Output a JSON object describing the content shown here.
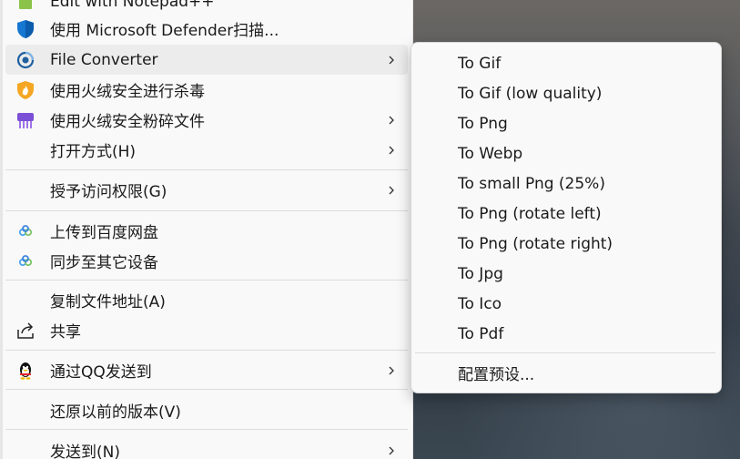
{
  "main_menu": {
    "items": [
      {
        "label": "Edit with Notepad++",
        "icon": "notepadpp-icon"
      },
      {
        "label": "使用 Microsoft Defender扫描...",
        "icon": "defender-shield-icon"
      },
      {
        "label": "File Converter",
        "icon": "file-converter-icon"
      },
      {
        "label": "使用火绒安全进行杀毒",
        "icon": "huorong-icon"
      },
      {
        "label": "使用火绒安全粉碎文件",
        "icon": "shredder-icon"
      },
      {
        "label": "打开方式(H)"
      },
      {
        "label": "授予访问权限(G)"
      },
      {
        "label": "上传到百度网盘",
        "icon": "baidu-netdisk-icon"
      },
      {
        "label": "同步至其它设备",
        "icon": "baidu-netdisk-icon"
      },
      {
        "label": "复制文件地址(A)"
      },
      {
        "label": "共享",
        "icon": "share-icon"
      },
      {
        "label": "通过QQ发送到",
        "icon": "qq-penguin-icon"
      },
      {
        "label": "还原以前的版本(V)"
      },
      {
        "label": "发送到(N)"
      }
    ]
  },
  "submenu": {
    "items": [
      {
        "label": "To Gif"
      },
      {
        "label": "To Gif (low quality)"
      },
      {
        "label": "To Png"
      },
      {
        "label": "To Webp"
      },
      {
        "label": "To small Png (25%)"
      },
      {
        "label": "To Png (rotate left)"
      },
      {
        "label": "To Png (rotate right)"
      },
      {
        "label": "To Jpg"
      },
      {
        "label": "To Ico"
      },
      {
        "label": "To Pdf"
      },
      {
        "label": "配置预设..."
      }
    ]
  },
  "colors": {
    "menu_bg": "#f9f9f9",
    "hover_bg": "#ececec",
    "text": "#1a1a1a",
    "separator": "#dcdcdc"
  }
}
